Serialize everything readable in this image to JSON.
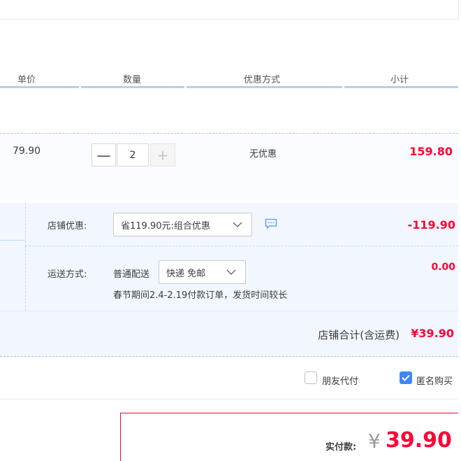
{
  "header": {
    "col_unit_price": "单价",
    "col_quantity": "数量",
    "col_discount_method": "优惠方式",
    "col_subtotal": "小计"
  },
  "item": {
    "unit_price": "79.90",
    "quantity": "2",
    "minus_symbol": "—",
    "plus_symbol": "+",
    "discount": "无优惠",
    "subtotal": "159.80"
  },
  "shop": {
    "promo_label": "店铺优惠:",
    "promo_selected": "省119.90元:组合优惠",
    "promo_value": "-119.90",
    "shipping_label": "运送方式:",
    "shipping_type": "普通配送",
    "shipping_selected": "快递 免邮",
    "shipping_value": "0.00",
    "holiday_notice": "春节期间2.4-2.19付款订单，发货时间较长",
    "total_label": "店铺合计(含运费)",
    "total_value": "¥39.90"
  },
  "options": {
    "friend_pay_label": "朋友代付",
    "friend_pay_checked": false,
    "anonymous_label": "匿名购买",
    "anonymous_checked": true
  },
  "payment": {
    "label": "实付款:",
    "currency": "¥",
    "amount": "39.90"
  },
  "colors": {
    "accent_red": "#ff0036",
    "header_line": "#b2d1f2",
    "shop_bg": "#f2f7ff",
    "checkbox_blue": "#3f87f5"
  }
}
